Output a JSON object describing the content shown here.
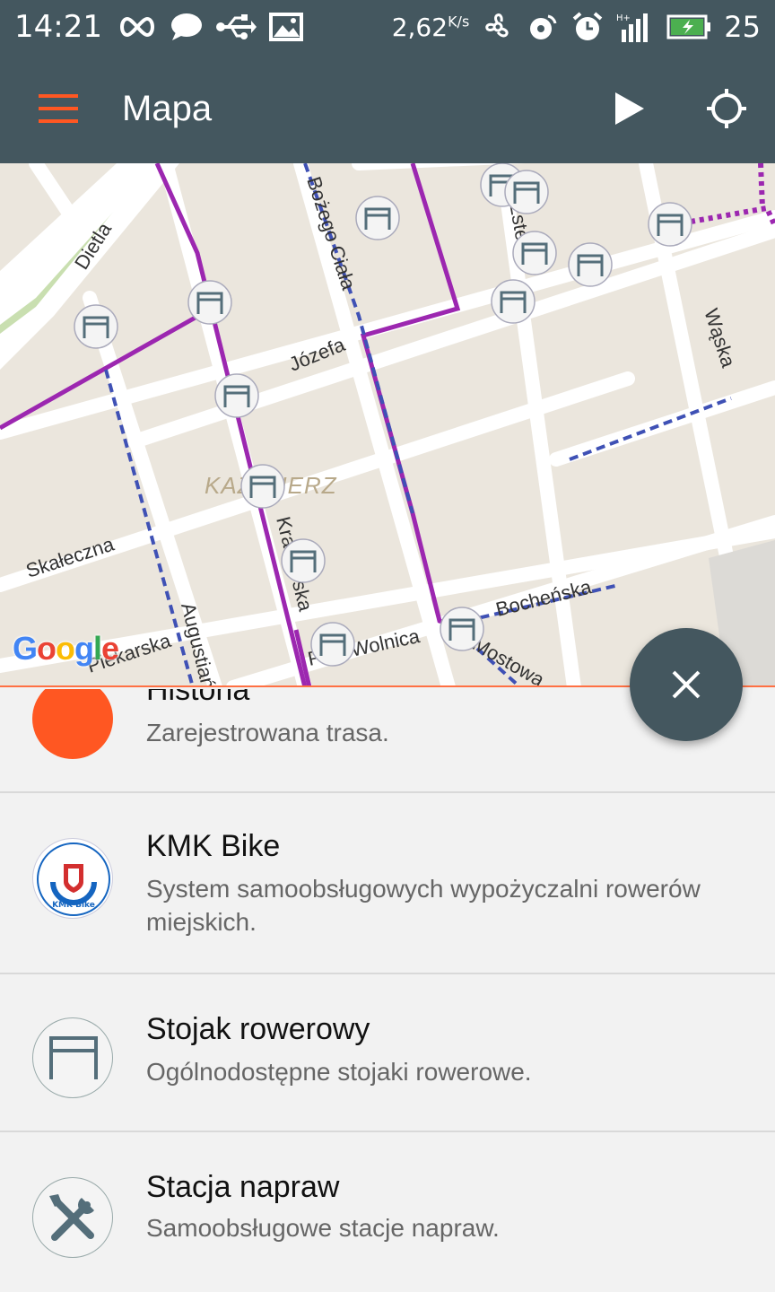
{
  "status_bar": {
    "time": "14:21",
    "speed": "2,62",
    "speed_unit": "K/s",
    "battery": "25",
    "icons": [
      "infinity-icon",
      "chat-icon",
      "usb-icon",
      "image-icon",
      "fan-icon",
      "nfc-icon",
      "alarm-icon",
      "signal-icon",
      "battery-icon"
    ]
  },
  "app_bar": {
    "title": "Mapa",
    "icons": [
      "menu-icon",
      "play-icon",
      "locate-icon"
    ],
    "accent_color": "#ff5722",
    "background_color": "#44575f"
  },
  "map": {
    "streets": [
      "Dietla",
      "Bożego Ciała",
      "Józefa",
      "Wąska",
      "Skałeczna",
      "Augustiańska",
      "Krakowska",
      "Piekarska",
      "Plac Wolnica",
      "Bocheńska",
      "Mostowa",
      "Estery"
    ],
    "district": "KAZIMIERZ",
    "attribution": "Google",
    "route_colors": {
      "bike_path": "#9c27b0",
      "bike_lane": "#3f51b5"
    }
  },
  "fab": {
    "icon": "close-icon"
  },
  "layers": [
    {
      "title": "Historia",
      "description": "Zarejestrowana trasa.",
      "icon": "history-dot-icon",
      "color": "#ff5722"
    },
    {
      "title": "KMK Bike",
      "description": "System samoobsługowych wypożyczalni rowerów miejskich.",
      "icon": "kmk-bike-logo-icon",
      "logo_text": "Komunikacja Miejska w Krakowie KMK Bike"
    },
    {
      "title": "Stojak rowerowy",
      "description": "Ogólnodostępne stojaki rowerowe.",
      "icon": "bike-rack-icon"
    },
    {
      "title": "Stacja napraw",
      "description": "Samoobsługowe stacje napraw.",
      "icon": "repair-tools-icon"
    }
  ]
}
